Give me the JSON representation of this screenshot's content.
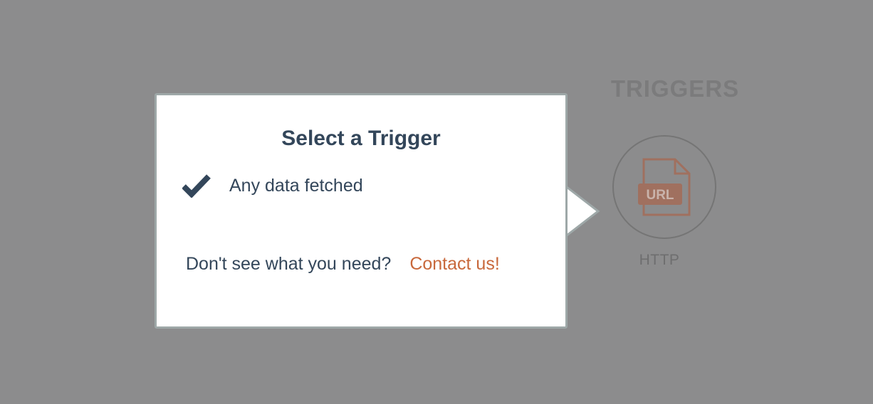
{
  "triggers_panel": {
    "heading": "TRIGGERS",
    "items": [
      {
        "icon_text": "URL",
        "label": "HTTP",
        "icon": "url-file-icon"
      }
    ]
  },
  "popover": {
    "title": "Select a Trigger",
    "options": [
      {
        "label": "Any data fetched",
        "selected": true,
        "icon": "checkmark-icon"
      }
    ],
    "footer_text": "Don't see what you need?",
    "contact_link": "Contact us!"
  },
  "colors": {
    "backdrop": "#8c8c8d",
    "title_text": "#33465a",
    "link": "#c8683b",
    "icon_accent": "#a0705f",
    "popover_border": "#9ea8a8"
  }
}
